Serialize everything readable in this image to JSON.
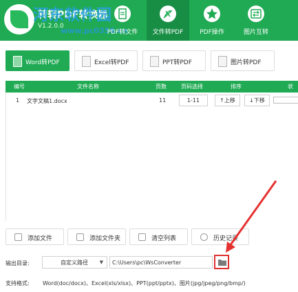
{
  "header": {
    "title": "转转PDF转换器",
    "version": "V1.2.0.0",
    "watermark": "河东软件园",
    "watermark_url": "www.pc0359.cn",
    "accent_color": "#1faa53",
    "top_tabs": [
      {
        "label": "PDF转文件",
        "icon": "pdf-to-file-icon"
      },
      {
        "label": "文件转PDF",
        "icon": "file-to-pdf-icon",
        "active": true
      },
      {
        "label": "PDF操作",
        "icon": "star-icon"
      },
      {
        "label": "图片互转",
        "icon": "image-convert-icon"
      }
    ]
  },
  "sub_tabs": [
    {
      "label": "Word转PDF",
      "active": true
    },
    {
      "label": "Excel转PDF"
    },
    {
      "label": "PPT转PDF"
    },
    {
      "label": "图片转PDF"
    }
  ],
  "table": {
    "columns": [
      "编号",
      "文件名称",
      "页数",
      "页码选择",
      "排序",
      "状"
    ],
    "rows": [
      {
        "index": "1",
        "name": "文字文稿1.docx",
        "pages": "11",
        "range": "1-11",
        "up": "↑上移",
        "down": "↓下移"
      }
    ]
  },
  "buttons": {
    "add_file": "添加文件",
    "add_folder": "添加文件夹",
    "clear_list": "清空列表",
    "history": "历史记录"
  },
  "output": {
    "label": "输出目录:",
    "mode": "自定义路径",
    "path": "C:\\Users\\pc\\WsConverter"
  },
  "support": {
    "label": "支持格式:",
    "text": "Word(doc/docx)、Excel(xls/xlsx)、PPT(ppt/pptx)、图片(jpg/jpeg/png/bmp/)"
  },
  "highlight_color": "#e03030"
}
